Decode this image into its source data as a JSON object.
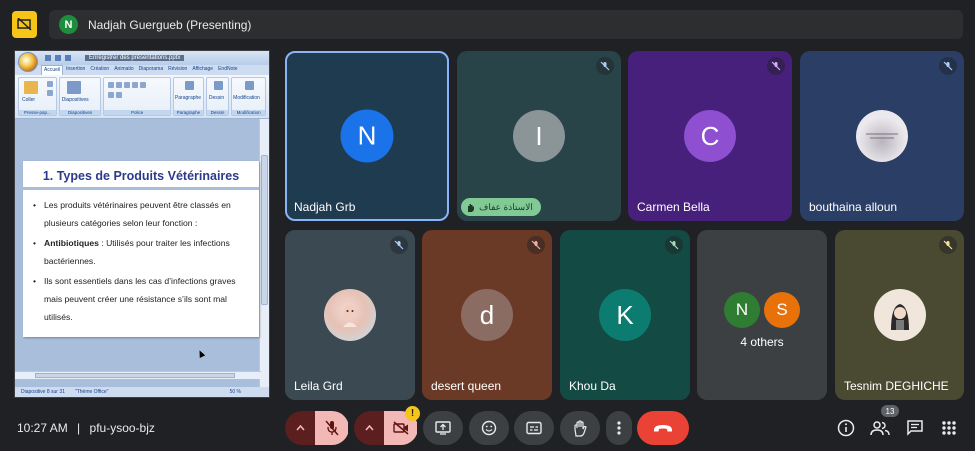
{
  "presenter": {
    "initial": "N",
    "label": "Nadjah Guergueb (Presenting)"
  },
  "slide": {
    "window_title": "Enregistrer des présentations.pptx",
    "tabs": [
      "Accueil",
      "Insertion",
      "Création",
      "Animatio",
      "Diaporama",
      "Révision",
      "Affichage",
      "EndNote"
    ],
    "groups": [
      "Presse-pap...",
      "Diapositives",
      "Police",
      "Paragraphe",
      "Dessin",
      "Modification"
    ],
    "group_labels": {
      "paste": "Coller",
      "slides": "Diapositives",
      "paragraph": "Paragraphe",
      "draw": "Dessin",
      "edit": "Modification"
    },
    "title": "1. Types de Produits Vétérinaires",
    "bullet1": "Les produits vétérinaires peuvent être classés en plusieurs catégories selon leur fonction :",
    "bullet2_bold": "Antibiotiques",
    "bullet2_rest": " : Utilisés pour traiter les infections bactériennes.",
    "bullet3": "Ils sont essentiels dans les cas d’infections graves mais peuvent créer une résistance s’ils sont mal utilisés.",
    "status_slide": "Diapositive 8 sur 31",
    "status_theme": "\"Thème Office\"",
    "status_zoom": "50 %"
  },
  "tiles": [
    {
      "name": "Nadjah Grb",
      "initial": "N",
      "avatar_color": "#1a73e8",
      "bg": "#1f3b4f"
    },
    {
      "name": "الاستاذة عفاف",
      "initial": "I",
      "avatar_color": "#8b9598",
      "bg": "#294448",
      "hand_raised": true
    },
    {
      "name": "Carmen Bella",
      "initial": "C",
      "avatar_color": "#8e4fd0",
      "bg": "#46207b"
    },
    {
      "name": "bouthaina alloun",
      "initial": "",
      "avatar_color": "#e8e6ea",
      "bg": "#2a3e66",
      "photo": true
    },
    {
      "name": "Leila Grd",
      "initial": "",
      "avatar_color": "#e8d7d4",
      "bg": "#3b4a52",
      "photo": true
    },
    {
      "name": "desert queen",
      "initial": "d",
      "avatar_color": "#8a6c63",
      "bg": "#6b3a26"
    },
    {
      "name": "Khou Da",
      "initial": "K",
      "avatar_color": "#0b7c6f",
      "bg": "#144a44"
    },
    {
      "name": "4 others",
      "bg": "#3c4043",
      "others": [
        {
          "initial": "N",
          "color": "#2e7d32"
        },
        {
          "initial": "S",
          "color": "#e8710a"
        }
      ]
    },
    {
      "name": "Tesnim DEGHICHE",
      "initial": "",
      "avatar_color": "#f1e6dc",
      "bg": "#4a4a32",
      "photo": true
    }
  ],
  "bottom": {
    "time": "10:27 AM",
    "separator": "|",
    "meeting_code": "pfu-ysoo-bjz",
    "people_count": "13",
    "warning": "!"
  },
  "colors": {
    "accent_blue": "#8ab4f8",
    "end_call": "#ea4335",
    "warning": "#f5c518"
  }
}
